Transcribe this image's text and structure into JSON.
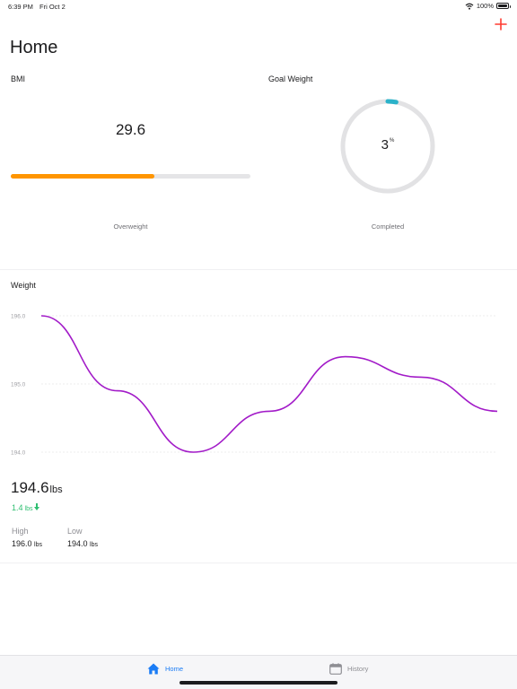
{
  "status_bar": {
    "time": "6:39 PM",
    "date": "Fri Oct 2",
    "battery": "100%"
  },
  "header": {
    "title": "Home",
    "add_icon": "plus-icon"
  },
  "bmi": {
    "label": "BMI",
    "value": "29.6",
    "status": "Overweight",
    "progress_fraction": 0.6,
    "bar_color": "#ff9500"
  },
  "goal": {
    "label": "Goal Weight",
    "value": "3",
    "unit": "%",
    "status": "Completed",
    "progress_percent": 3,
    "ring_color": "#2bb2c9"
  },
  "weight": {
    "label": "Weight",
    "current_value": "194.6",
    "current_unit": "lbs",
    "change_value": "1.4",
    "change_unit": "lbs",
    "change_icon": "arrow-down-icon",
    "high_label": "High",
    "high_value": "196.0",
    "high_unit": "lbs",
    "low_label": "Low",
    "low_value": "194.0",
    "low_unit": "lbs"
  },
  "chart_data": {
    "type": "line",
    "y_ticks": [
      "196.0",
      "195.0",
      "194.0"
    ],
    "ylim": [
      194.0,
      196.0
    ],
    "grid": true,
    "series": [
      {
        "color": "#a21bc8",
        "points": [
          196.0,
          194.9,
          194.0,
          194.6,
          195.4,
          195.1,
          194.6
        ]
      }
    ]
  },
  "tabs": [
    {
      "label": "Home",
      "icon": "home-icon",
      "active": true
    },
    {
      "label": "History",
      "icon": "calendar-icon",
      "active": false
    }
  ]
}
